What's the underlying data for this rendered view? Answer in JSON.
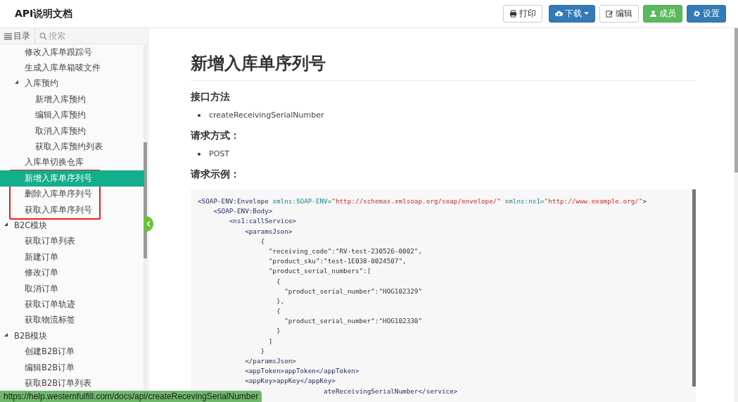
{
  "header": {
    "title": "API说明文档",
    "buttons": [
      {
        "label": "打印",
        "kind": "default",
        "dropdown": false
      },
      {
        "label": "下载",
        "kind": "primary",
        "dropdown": true
      },
      {
        "label": "编辑",
        "kind": "default",
        "dropdown": false
      },
      {
        "label": "成员",
        "kind": "success",
        "dropdown": false
      },
      {
        "label": "设置",
        "kind": "primary",
        "dropdown": false
      }
    ]
  },
  "sidebar": {
    "tabs": [
      {
        "label": "目录"
      },
      {
        "label": "搜索"
      }
    ],
    "tree": [
      {
        "children": [
          {
            "label": "修改入库单跟踪号",
            "selected": false
          },
          {
            "label": "生成入库单箱唛文件",
            "selected": false
          },
          {
            "label": "入库预约",
            "selected": false,
            "expanded": true,
            "children": [
              {
                "label": "新增入库预约",
                "selected": false
              },
              {
                "label": "编辑入库预约",
                "selected": false
              },
              {
                "label": "取消入库预约",
                "selected": false
              },
              {
                "label": "获取入库预约列表",
                "selected": false
              }
            ]
          },
          {
            "label": "入库单切换仓库",
            "selected": false
          },
          {
            "label": "新增入库单序列号",
            "selected": true
          },
          {
            "label": "删除入库单序列号",
            "selected": false
          },
          {
            "label": "获取入库单序列号",
            "selected": false
          }
        ]
      },
      {
        "label": "B2C模块",
        "selected": false,
        "expanded": true,
        "children": [
          {
            "label": "获取订单列表",
            "selected": false
          },
          {
            "label": "新建订单",
            "selected": false
          },
          {
            "label": "修改订单",
            "selected": false
          },
          {
            "label": "取消订单",
            "selected": false
          },
          {
            "label": "获取订单轨迹",
            "selected": false
          },
          {
            "label": "获取物流标签",
            "selected": false
          }
        ]
      },
      {
        "label": "B2B模块",
        "selected": false,
        "expanded": true,
        "children": [
          {
            "label": "创建B2B订单",
            "selected": false
          },
          {
            "label": "编辑B2B订单",
            "selected": false
          },
          {
            "label": "获取B2B订单列表",
            "selected": false
          }
        ]
      }
    ]
  },
  "article": {
    "title": "新增入库单序列号",
    "sections": [
      {
        "heading": "接口方法",
        "bullets": [
          "createReceivingSerialNumber"
        ]
      },
      {
        "heading": "请求方式：",
        "bullets": [
          "POST"
        ]
      },
      {
        "heading": "请求示例：",
        "code": [
          [
            {
              "kind": "tag",
              "text": "<SOAP-ENV:Envelope "
            },
            {
              "kind": "attr",
              "text": "xmlns:SOAP-ENV="
            },
            {
              "kind": "string",
              "text": "\"http://schemas.xmlsoap.org/soap/envelope/\""
            },
            {
              "kind": "attr",
              "text": " xmlns:ns1="
            },
            {
              "kind": "string",
              "text": "\"http://www.example.org/\""
            },
            {
              "kind": "tag",
              "text": ">"
            }
          ],
          [
            {
              "kind": "tag",
              "text": "    <SOAP-ENV:Body>"
            }
          ],
          [
            {
              "kind": "tag",
              "text": "        <ns1:callService>"
            }
          ],
          [
            {
              "kind": "tag",
              "text": "            <paramsJson>"
            }
          ],
          [
            {
              "kind": "text",
              "text": "                {"
            }
          ],
          [
            {
              "kind": "text",
              "text": "                  \"receiving_code\":\"RV-test-230526-0002\","
            }
          ],
          [
            {
              "kind": "text",
              "text": "                  \"product_sku\":\"test-1E038-0024507\","
            }
          ],
          [
            {
              "kind": "text",
              "text": "                  \"product_serial_numbers\":["
            }
          ],
          [
            {
              "kind": "text",
              "text": "                    {"
            }
          ],
          [
            {
              "kind": "text",
              "text": "                      \"product_serial_number\":\"HOG102329\""
            }
          ],
          [
            {
              "kind": "text",
              "text": "                    },"
            }
          ],
          [
            {
              "kind": "text",
              "text": "                    {"
            }
          ],
          [
            {
              "kind": "text",
              "text": "                      \"product_serial_number\":\"HOG102330\""
            }
          ],
          [
            {
              "kind": "text",
              "text": "                    }"
            }
          ],
          [
            {
              "kind": "text",
              "text": "                  ]"
            }
          ],
          [
            {
              "kind": "text",
              "text": "                }"
            }
          ],
          [
            {
              "kind": "tag",
              "text": "            </paramsJson>"
            }
          ],
          [
            {
              "kind": "tag",
              "text": "            <appToken>appToken</appToken>"
            }
          ],
          [
            {
              "kind": "tag",
              "text": "            <appKey>appKey</appKey>"
            }
          ],
          [
            {
              "kind": "tag",
              "text": "                                ateReceivingSerialNumber</service>"
            }
          ]
        ]
      }
    ]
  },
  "status_bar": {
    "url": "https://help.westernfulfill.com/docs/api/createRecevingSerialNumber"
  }
}
